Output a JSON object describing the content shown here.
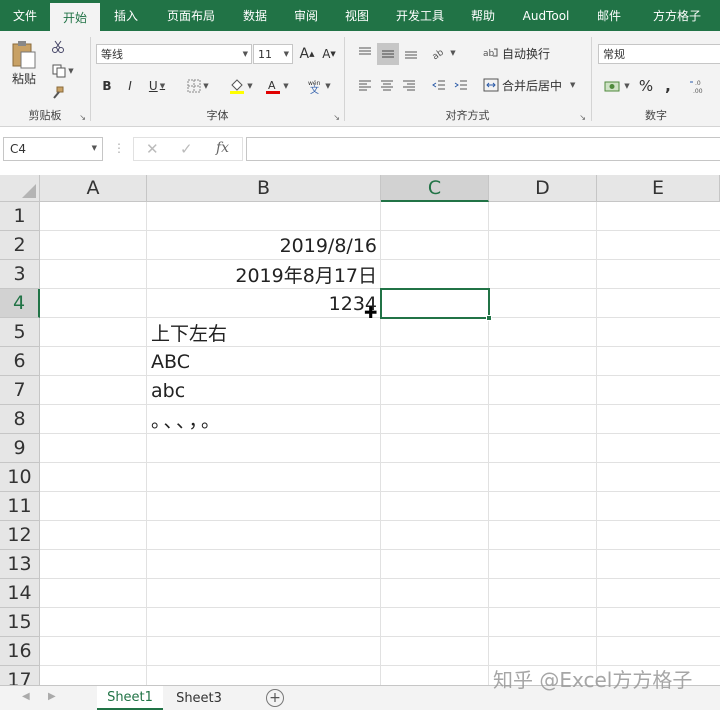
{
  "ribbon_tabs": [
    "文件",
    "开始",
    "插入",
    "页面布局",
    "数据",
    "审阅",
    "视图",
    "开发工具",
    "帮助",
    "AudTool",
    "邮件",
    "方方格子"
  ],
  "clipboard": {
    "paste_label": "粘贴",
    "group_label": "剪贴板"
  },
  "font": {
    "name": "等线",
    "size": "11",
    "group_label": "字体",
    "bold": "B",
    "italic": "I",
    "underline": "U",
    "grow": "A",
    "shrink": "A"
  },
  "alignment": {
    "wrap_text": "自动换行",
    "merge_center": "合并后居中",
    "group_label": "对齐方式"
  },
  "number": {
    "format": "常规",
    "percent": "%",
    "comma": ",",
    "group_label": "数字"
  },
  "formula_bar": {
    "name_box": "C4",
    "cancel": "✕",
    "enter": "✓",
    "fx": "fx",
    "formula": ""
  },
  "columns": [
    "A",
    "B",
    "C",
    "D",
    "E"
  ],
  "rows": [
    "1",
    "2",
    "3",
    "4",
    "5",
    "6",
    "7",
    "8",
    "9",
    "10",
    "11",
    "12",
    "13",
    "14",
    "15",
    "16",
    "17"
  ],
  "cells": {
    "B2": "2019/8/16",
    "B3": "2019年8月17日",
    "B4": "1234",
    "B5": "上下左右",
    "B6": "ABC",
    "B7": "abc",
    "B8": "。、、，。"
  },
  "sheets": [
    "Sheet1",
    "Sheet3"
  ],
  "active_sheet": "Sheet1",
  "watermark": "知乎 @Excel方方格子",
  "colors": {
    "accent": "#217346",
    "ribbon_bg": "#f3f3f3",
    "header_bg": "#e6e6e6"
  }
}
